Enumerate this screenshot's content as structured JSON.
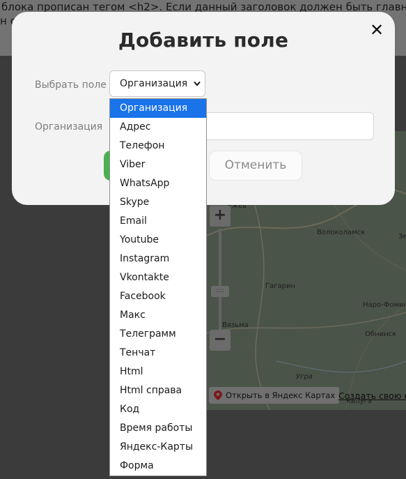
{
  "background": {
    "text_line1": "блока прописан тегом <h2>. Если данный заголовок должен быть главным",
    "text_line2": "н ст",
    "map": {
      "cities": [
        "Ржев",
        "Волоколамск",
        "Гагарин",
        "Вязьма",
        "Наро-Фомин",
        "Обнинск",
        "Угра",
        "Калуга",
        "Зе"
      ],
      "zoom_in": "+",
      "zoom_out": "−",
      "zoom_handle": "::::",
      "open_link": "Открыть в Яндекс Картах",
      "create_link": "Создать свою ка"
    }
  },
  "modal": {
    "title": "Добавить поле",
    "close": "✕",
    "select_label": "Выбрать поле",
    "select_value": "Организация",
    "input_label": "Организация",
    "cancel_label": "Отменить"
  },
  "dropdown": {
    "selected_index": 0,
    "options": [
      "Организация",
      "Адрес",
      "Телефон",
      "Viber",
      "WhatsApp",
      "Skype",
      "Email",
      "Youtube",
      "Instagram",
      "Vkontakte",
      "Facebook",
      "Макс",
      "Телеграмм",
      "Тенчат",
      "Html",
      "Html справа",
      "Код",
      "Время работы",
      "Яндекс-Карты",
      "Форма"
    ]
  },
  "colors": {
    "selected_option": "#1a73e8",
    "confirm_button": "#4caf50"
  }
}
